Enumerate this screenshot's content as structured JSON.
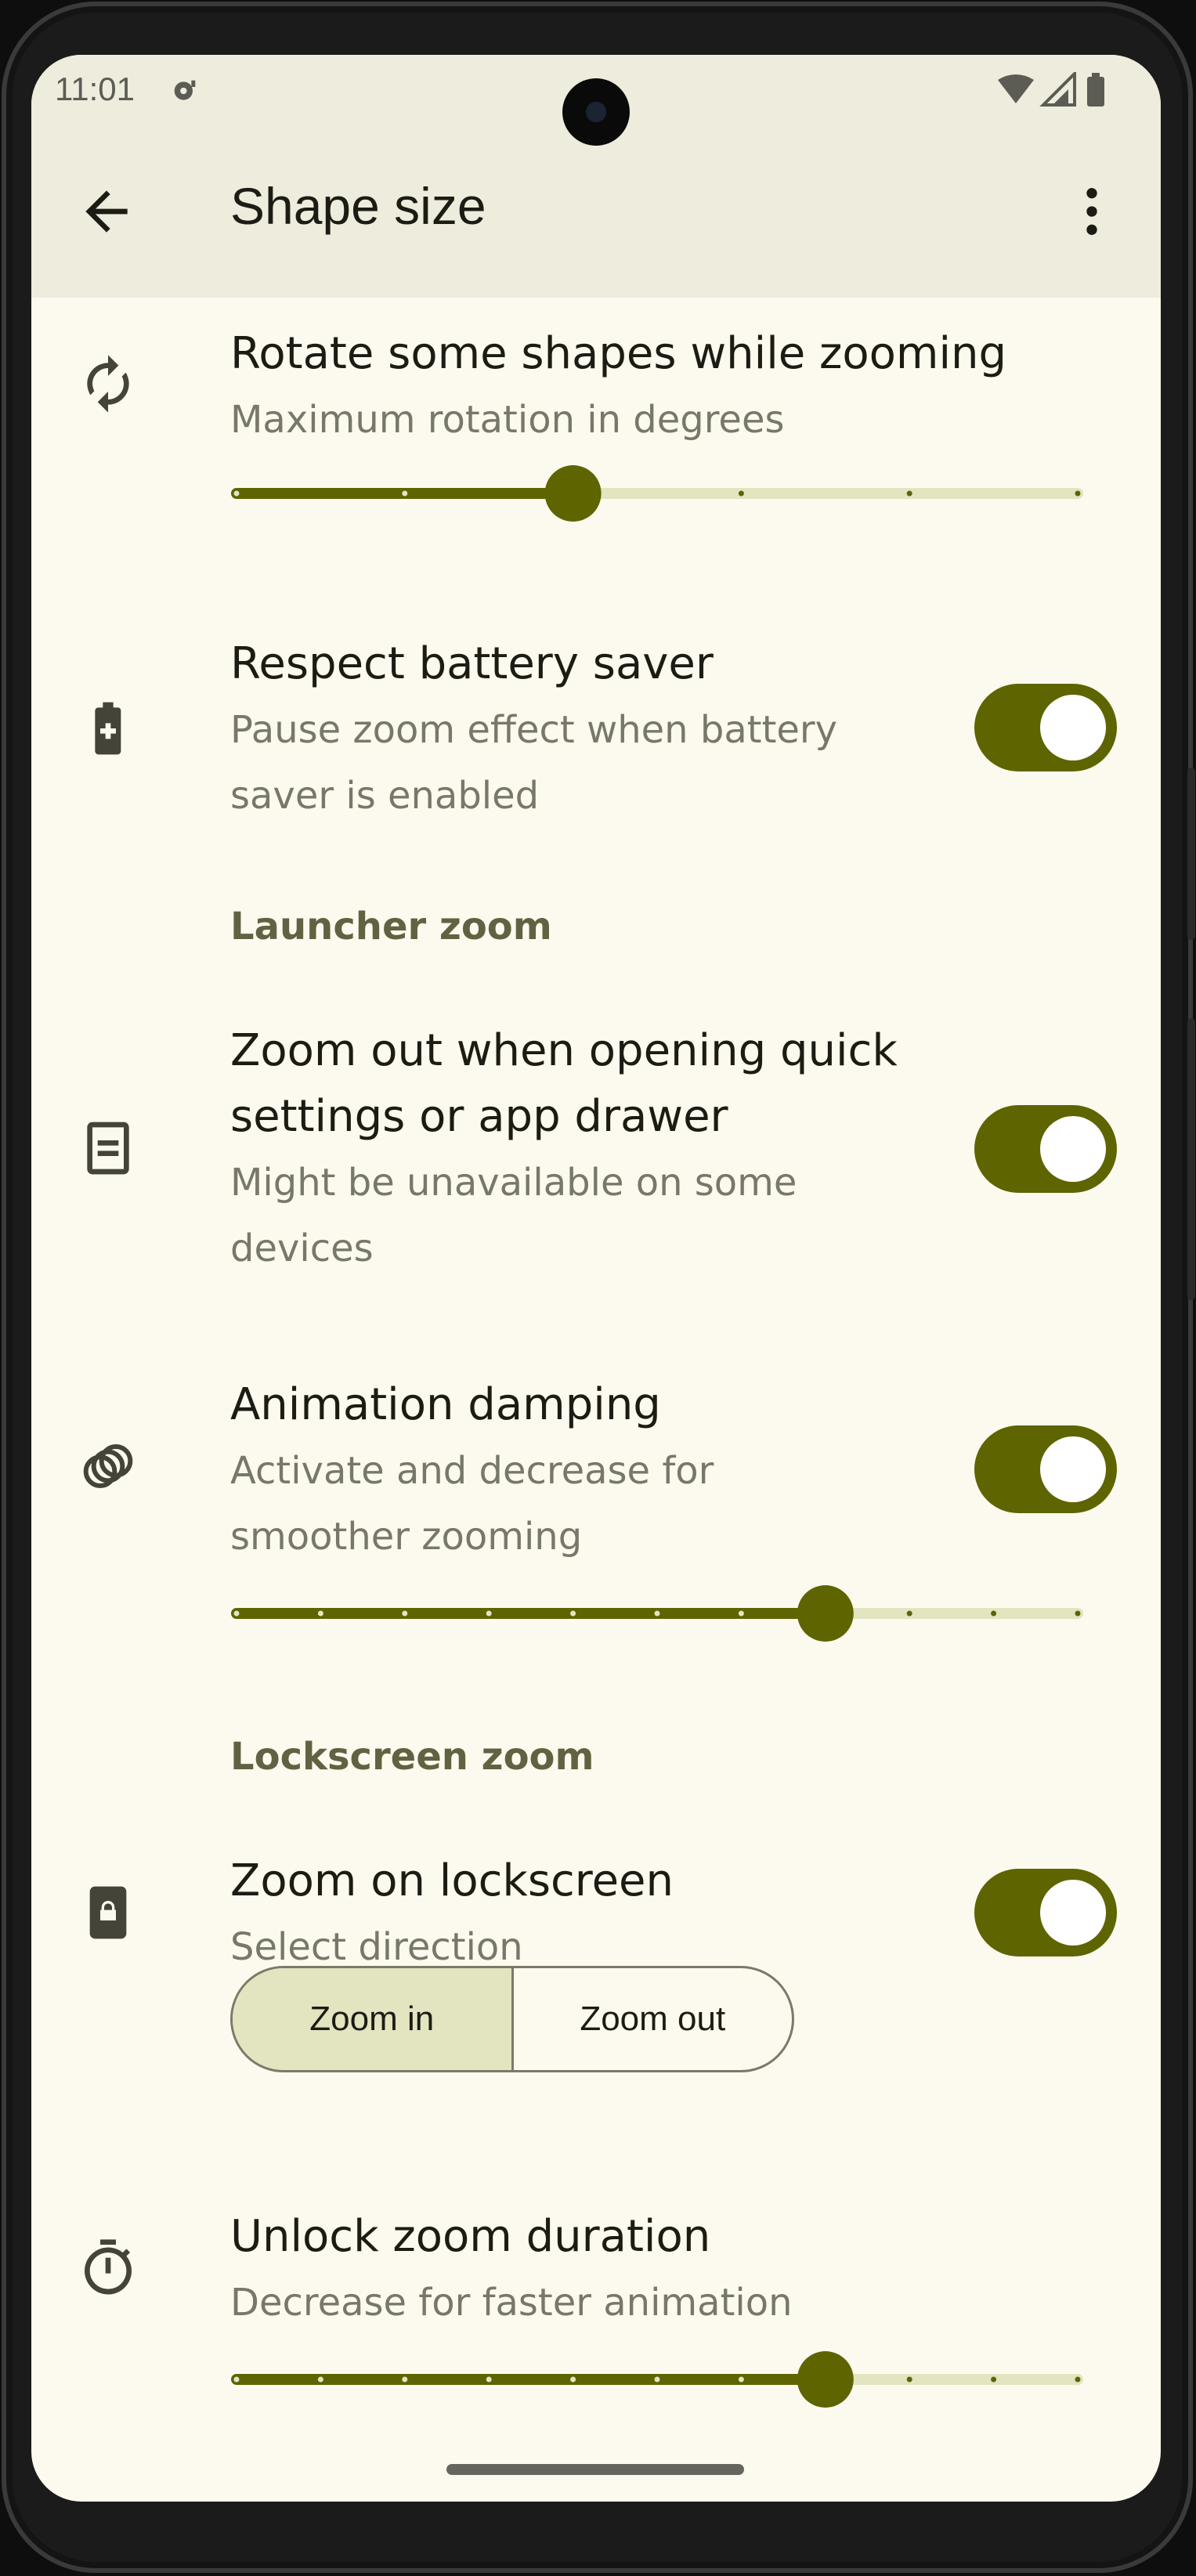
{
  "status": {
    "time": "11:01"
  },
  "header": {
    "title": "Shape size"
  },
  "rows": {
    "rotate": {
      "title": "Rotate some shapes while zooming",
      "subtitle": "Maximum rotation in degrees",
      "slider_fraction": 0.4,
      "steps": 5
    },
    "battery": {
      "title": "Respect battery saver",
      "subtitle_l1": "Pause zoom effect when battery",
      "subtitle_l2": "saver is enabled",
      "enabled": true
    },
    "launcher_section": "Launcher zoom",
    "quick_settings": {
      "title_l1": "Zoom out when opening quick",
      "title_l2": "settings or app drawer",
      "subtitle_l1": "Might be unavailable on some",
      "subtitle_l2": "devices",
      "enabled": true
    },
    "damping": {
      "title": "Animation damping",
      "subtitle_l1": "Activate and decrease for",
      "subtitle_l2": "smoother zooming",
      "enabled": true,
      "slider_fraction": 0.7,
      "steps": 10
    },
    "lockscreen_section": "Lockscreen zoom",
    "lockscreen": {
      "title": "Zoom on lockscreen",
      "subtitle": "Select direction",
      "enabled": true,
      "options": [
        "Zoom in",
        "Zoom out"
      ],
      "selected": "Zoom in"
    },
    "unlock": {
      "title": "Unlock zoom duration",
      "subtitle": "Decrease for faster animation",
      "slider_fraction": 0.7,
      "steps": 10
    }
  },
  "colors": {
    "accent": "#5e6400",
    "track": "#e3e4c0",
    "background": "#fcfaee",
    "appbar": "#eeecdc"
  }
}
